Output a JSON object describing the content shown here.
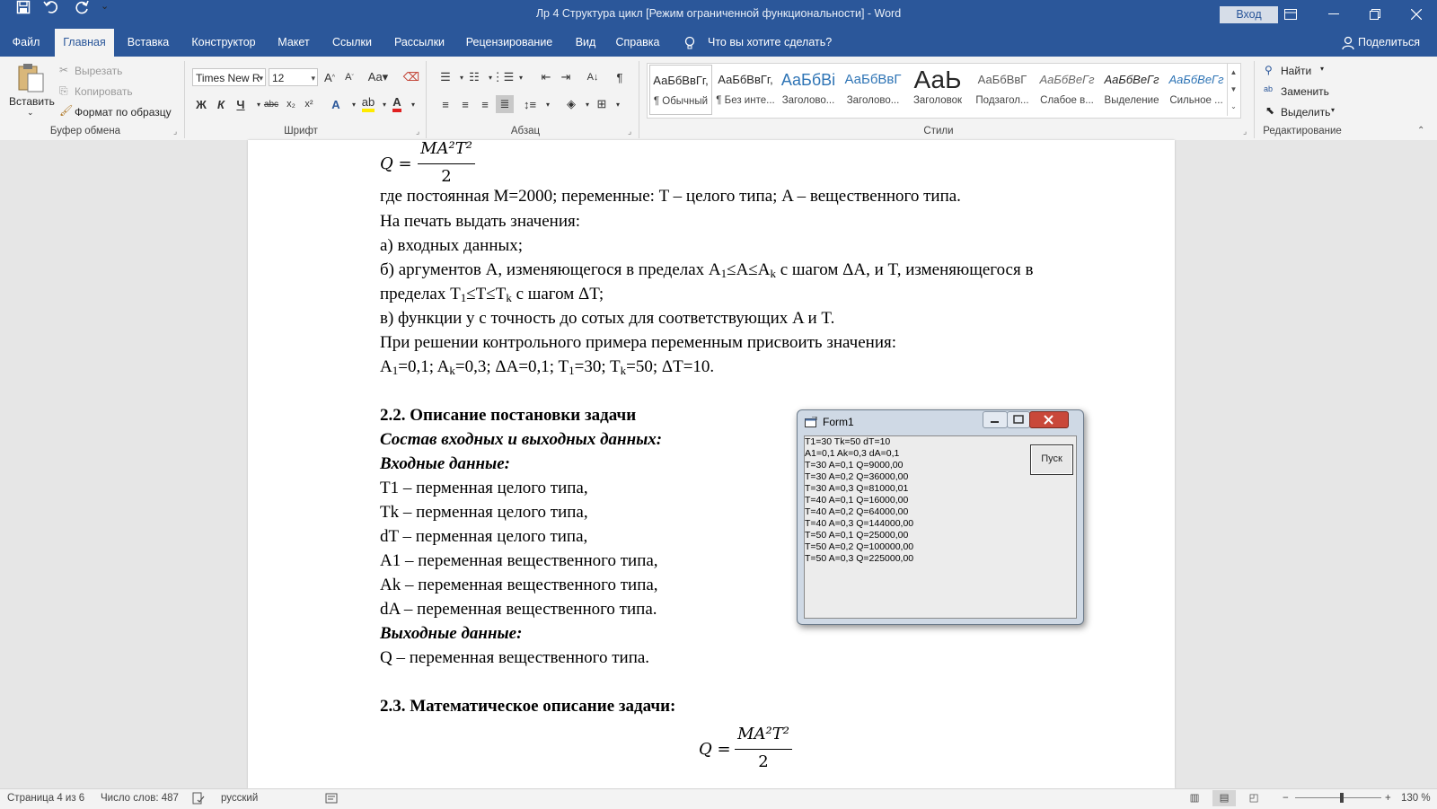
{
  "window": {
    "title": "Лр 4 Структура цикл [Режим ограниченной функциональности]  -  Word",
    "login_label": "Вход"
  },
  "tabs": [
    "Файл",
    "Главная",
    "Вставка",
    "Конструктор",
    "Макет",
    "Ссылки",
    "Рассылки",
    "Рецензирование",
    "Вид",
    "Справка"
  ],
  "tell_me": "Что вы хотите сделать?",
  "share_label": "Поделиться",
  "ribbon": {
    "clipboard": {
      "paste": "Вставить",
      "cut": "Вырезать",
      "copy": "Копировать",
      "format_painter": "Формат по образцу",
      "label": "Буфер обмена"
    },
    "font": {
      "font_name": "Times New R",
      "font_size": "12",
      "label": "Шрифт"
    },
    "paragraph": {
      "label": "Абзац"
    },
    "styles": {
      "label": "Стили",
      "items": [
        {
          "preview": "АаБбВвГг,",
          "name": "¶ Обычный"
        },
        {
          "preview": "АаБбВвГг,",
          "name": "¶ Без инте..."
        },
        {
          "preview": "АаБбВі",
          "name": "Заголово..."
        },
        {
          "preview": "АаБбВвГ",
          "name": "Заголово..."
        },
        {
          "preview": "АаЬ",
          "name": "Заголовок"
        },
        {
          "preview": "АаБбВвГ",
          "name": "Подзагол..."
        },
        {
          "preview": "АаБбВеГг",
          "name": "Слабое в..."
        },
        {
          "preview": "АаБбВеГг",
          "name": "Выделение"
        },
        {
          "preview": "АаБбВеГг",
          "name": "Сильное ..."
        }
      ]
    },
    "editing": {
      "label": "Редактирование",
      "find": "Найти",
      "replace": "Заменить",
      "select": "Выделить"
    }
  },
  "document": {
    "formula_top": {
      "num": "MA²T²",
      "den": "2",
      "lhs": "Q ="
    },
    "p1": "где постоянная M=2000; переменные: T – целого типа; A – вещественного типа.",
    "p2": "На печать выдать значения:",
    "p3": "а) входных данных;",
    "p4a": "б) аргументов A, изменяющегося в пределах A",
    "p4a_sub1": "1",
    "p4b": "≤A≤A",
    "p4b_sub": "k",
    "p4c": " с шагом ΔA, и T, изменяющегося в",
    "p5a": "пределах T",
    "p5a_sub": "1",
    "p5b": "≤T≤T",
    "p5b_sub": "k",
    "p5c": " с шагом ΔT;",
    "p6": "в) функции y с точность до сотых для соответствующих A и T.",
    "p7": "При решении контрольного примера переменным присвоить значения:",
    "p8a": "A",
    "p8a_sub": "1",
    "p8b": "=0,1; A",
    "p8b_sub": "k",
    "p8c": "=0,3; ΔA=0,1; T",
    "p8c_sub": "1",
    "p8d": "=30; T",
    "p8d_sub": "k",
    "p8e": "=50; ΔT=10.",
    "h22": "2.2.  Описание постановки задачи",
    "sub1": "Состав входных и выходных данных:",
    "sub2": "Входные данные:",
    "inputs": [
      "T1 – перменная целого типа,",
      "Tk – перменная целого типа,",
      "dT – перменная целого типа,",
      "A1 – переменная вещественного типа,",
      "Ak – переменная вещественного типа,",
      "dA – переменная вещественного типа."
    ],
    "sub3": "Выходные данные:",
    "output": "Q – переменная вещественного типа.",
    "h23": "2.3. Математическое описание задачи:",
    "formula_bottom": {
      "num": "MA²T²",
      "den": "2",
      "lhs": "Q ="
    }
  },
  "form1": {
    "title": "Form1",
    "button": "Пуск",
    "lines": [
      "T1=30 Tk=50 dT=10",
      "A1=0,1 Ak=0,3 dA=0,1",
      "T=30 A=0,1 Q=9000,00",
      "T=30 A=0,2 Q=36000,00",
      "T=30 A=0,3 Q=81000,01",
      "T=40 A=0,1 Q=16000,00",
      "T=40 A=0,2 Q=64000,00",
      "T=40 A=0,3 Q=144000,00",
      "T=50 A=0,1 Q=25000,00",
      "T=50 A=0,2 Q=100000,00",
      "T=50 A=0,3 Q=225000,00"
    ]
  },
  "status": {
    "page": "Страница 4 из 6",
    "words": "Число слов: 487",
    "language": "русский",
    "zoom": "130 %",
    "zoom_level": 1.3
  },
  "colors": {
    "titlebar": "#2b579a",
    "ribbon": "#f3f3f3",
    "canvas": "#e6e6e6"
  }
}
